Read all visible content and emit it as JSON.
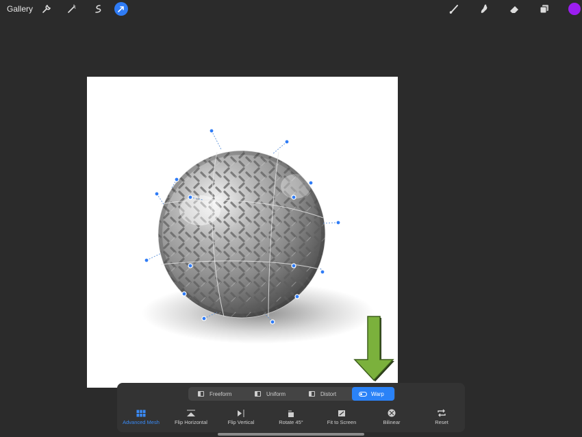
{
  "topbar": {
    "gallery_label": "Gallery",
    "left_tools": [
      "wrench-icon",
      "magic-wand-icon",
      "selection-icon",
      "transform-arrow-icon"
    ],
    "right_tools": [
      "brush-icon",
      "smudge-icon",
      "eraser-icon",
      "layers-icon"
    ],
    "current_color": "#9b1ef0"
  },
  "transform_modes": {
    "items": [
      {
        "label": "Freeform",
        "active": false
      },
      {
        "label": "Uniform",
        "active": false
      },
      {
        "label": "Distort",
        "active": false
      },
      {
        "label": "Warp",
        "active": true
      }
    ]
  },
  "actions": {
    "items": [
      {
        "label": "Advanced Mesh",
        "icon": "mesh-grid-icon",
        "active": true
      },
      {
        "label": "Flip Horizontal",
        "icon": "flip-horizontal-icon",
        "active": false
      },
      {
        "label": "Flip Vertical",
        "icon": "flip-vertical-icon",
        "active": false
      },
      {
        "label": "Rotate 45°",
        "icon": "rotate-icon",
        "active": false
      },
      {
        "label": "Fit to Screen",
        "icon": "fit-to-screen-icon",
        "active": false
      },
      {
        "label": "Bilinear",
        "icon": "bilinear-icon",
        "active": false
      },
      {
        "label": "Reset",
        "icon": "reset-icon",
        "active": false
      }
    ]
  },
  "colors": {
    "accent": "#2a82f7",
    "panel": "#333333",
    "background": "#2b2b2b",
    "arrow_green": "#7bb13c"
  }
}
